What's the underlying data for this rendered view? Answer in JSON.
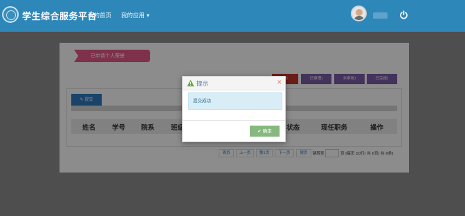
{
  "header": {
    "app_title": "学生综合服务平台",
    "nav": [
      "我的首页",
      "我的应用 ▾"
    ]
  },
  "panel": {
    "tag": "已申请个人荣誉",
    "filters": [
      "(0)",
      "已审理)",
      "未审核)",
      "已完成)"
    ],
    "submit_label": "✎ 提交",
    "columns": [
      "姓名",
      "学号",
      "院系",
      "班级",
      "状态",
      "现任职务",
      "操作"
    ],
    "pager": {
      "buttons": [
        "首页",
        "上一页",
        "第1页",
        "下一页",
        "尾页"
      ],
      "goto": "跳转至",
      "summary": "页 [每页 10行/ 共 0页/ 共 0条]"
    }
  },
  "dialog": {
    "title": "提示",
    "message": "提交成功",
    "ok_label": "✔ 确定"
  },
  "colors": {
    "header": "#2e87b9",
    "tag": "#e85a8a",
    "filter_purple": "#7a5ea8",
    "filter_red": "#c2362b",
    "confirm": "#87b87f"
  }
}
